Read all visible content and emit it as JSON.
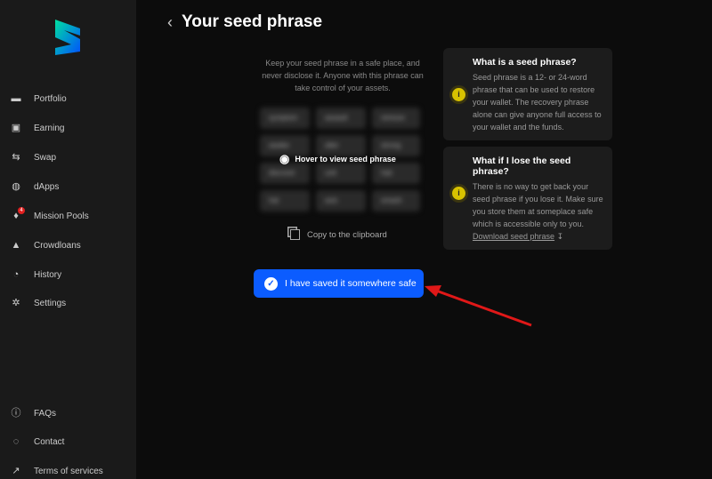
{
  "sidebar": {
    "items": [
      {
        "label": "Portfolio",
        "icon": "wallet-icon"
      },
      {
        "label": "Earning",
        "icon": "safe-icon"
      },
      {
        "label": "Swap",
        "icon": "swap-icon"
      },
      {
        "label": "dApps",
        "icon": "globe-icon"
      },
      {
        "label": "Mission Pools",
        "icon": "rocket-badge-icon",
        "badge": "4"
      },
      {
        "label": "Crowdloans",
        "icon": "rocket-icon"
      },
      {
        "label": "History",
        "icon": "clock-icon"
      },
      {
        "label": "Settings",
        "icon": "gear-icon"
      }
    ],
    "footer": [
      {
        "label": "FAQs",
        "icon": "info-icon"
      },
      {
        "label": "Contact",
        "icon": "messenger-icon"
      },
      {
        "label": "Terms of services",
        "icon": "external-link-icon"
      }
    ]
  },
  "header": {
    "title": "Your seed phrase"
  },
  "main": {
    "intro": "Keep your seed phrase in a safe place, and never disclose it. Anyone with this phrase can take control of your assets.",
    "words": [
      "symptom",
      "assault",
      "remove",
      "awake",
      "alter",
      "strong",
      "discover",
      "unit",
      "hair",
      "hat",
      "axis",
      "smash"
    ],
    "hover_label": "Hover to view seed phrase",
    "copy_label": "Copy to the clipboard",
    "confirm_label": "I have saved it somewhere safe"
  },
  "cards": [
    {
      "title": "What is a seed phrase?",
      "body": "Seed phrase is a 12- or 24-word phrase that can be used to restore your wallet. The recovery phrase alone can give anyone full access to your wallet and the funds."
    },
    {
      "title": "What if I lose the seed phrase?",
      "body": "There is no way to get back your seed phrase if you lose it. Make sure you store them at someplace safe which is accessible only to you.",
      "link": "Download seed phrase"
    }
  ],
  "colors": {
    "accent": "#0b5cff",
    "annotation": "#e01818"
  }
}
